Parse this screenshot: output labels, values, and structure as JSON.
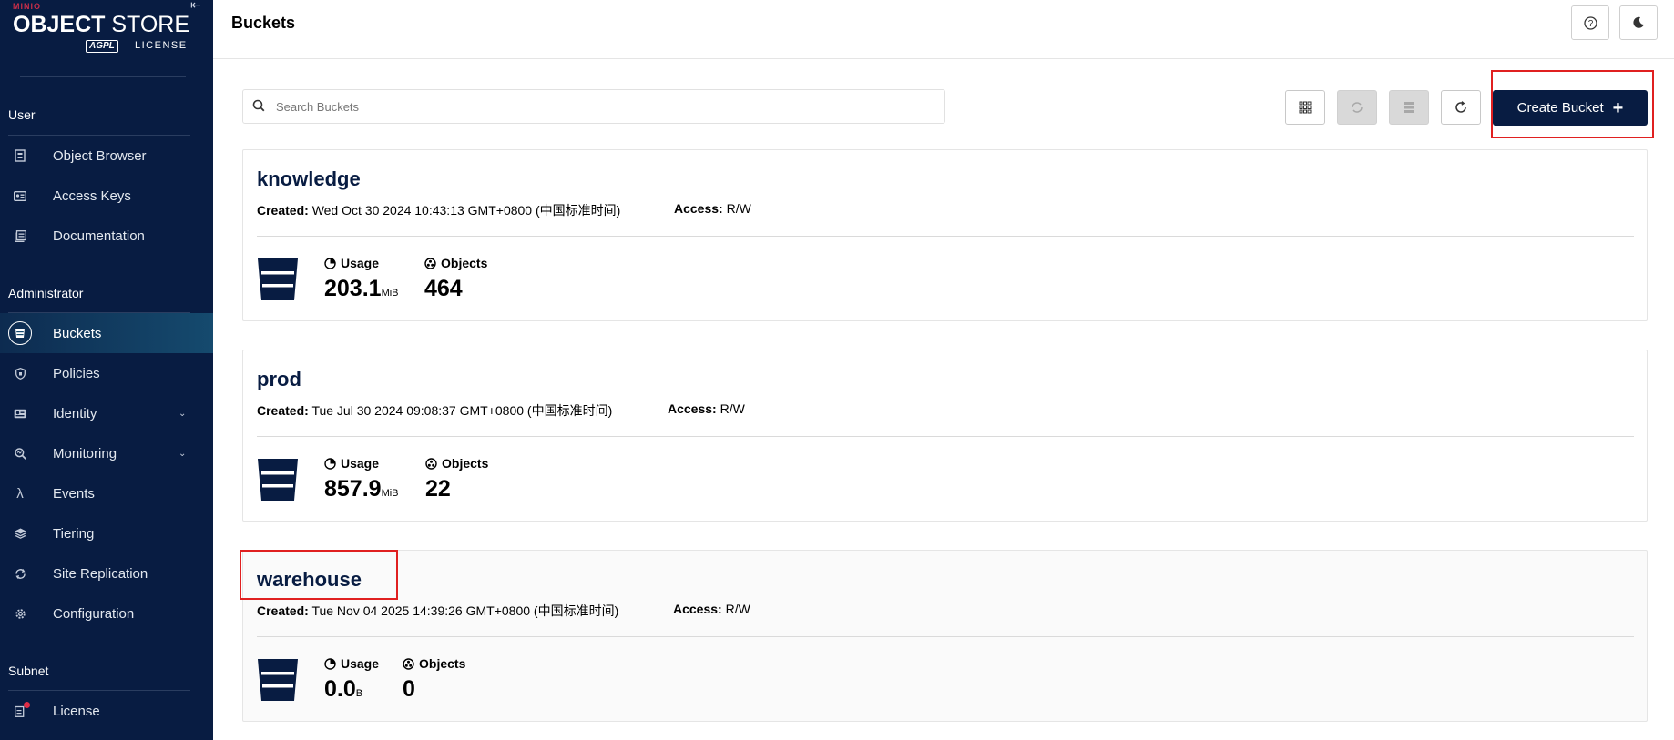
{
  "brand": {
    "vendor": "MINIO",
    "product_bold": "OBJECT",
    "product_light": " STORE",
    "badge": "AGPL",
    "license": "LICENSE"
  },
  "sidebar": {
    "sections": {
      "user": "User",
      "administrator": "Administrator",
      "subnet": "Subnet"
    },
    "items": {
      "object_browser": "Object Browser",
      "access_keys": "Access Keys",
      "documentation": "Documentation",
      "buckets": "Buckets",
      "policies": "Policies",
      "identity": "Identity",
      "monitoring": "Monitoring",
      "events": "Events",
      "tiering": "Tiering",
      "site_replication": "Site Replication",
      "configuration": "Configuration",
      "license": "License"
    },
    "active_item": "buckets"
  },
  "header": {
    "title": "Buckets"
  },
  "search": {
    "placeholder": "Search Buckets",
    "value": ""
  },
  "toolbar": {
    "create_label": "Create Bucket"
  },
  "labels": {
    "created": "Created:",
    "access": "Access:",
    "usage": "Usage",
    "objects": "Objects"
  },
  "buckets": [
    {
      "name": "knowledge",
      "created": "Wed Oct 30 2024 10:43:13 GMT+0800 (中国标准时间)",
      "access": "R/W",
      "usage": "203.1",
      "usage_unit": "MiB",
      "objects": "464"
    },
    {
      "name": "prod",
      "created": "Tue Jul 30 2024 09:08:37 GMT+0800 (中国标准时间)",
      "access": "R/W",
      "usage": "857.9",
      "usage_unit": "MiB",
      "objects": "22"
    },
    {
      "name": "warehouse",
      "created": "Tue Nov 04 2025 14:39:26 GMT+0800 (中国标准时间)",
      "access": "R/W",
      "usage": "0.0",
      "usage_unit": "B",
      "objects": "0"
    }
  ],
  "colors": {
    "sidebar_bg": "#081c42",
    "primary": "#081c42",
    "highlight": "#e02020",
    "alert_dot": "#e02d46"
  }
}
